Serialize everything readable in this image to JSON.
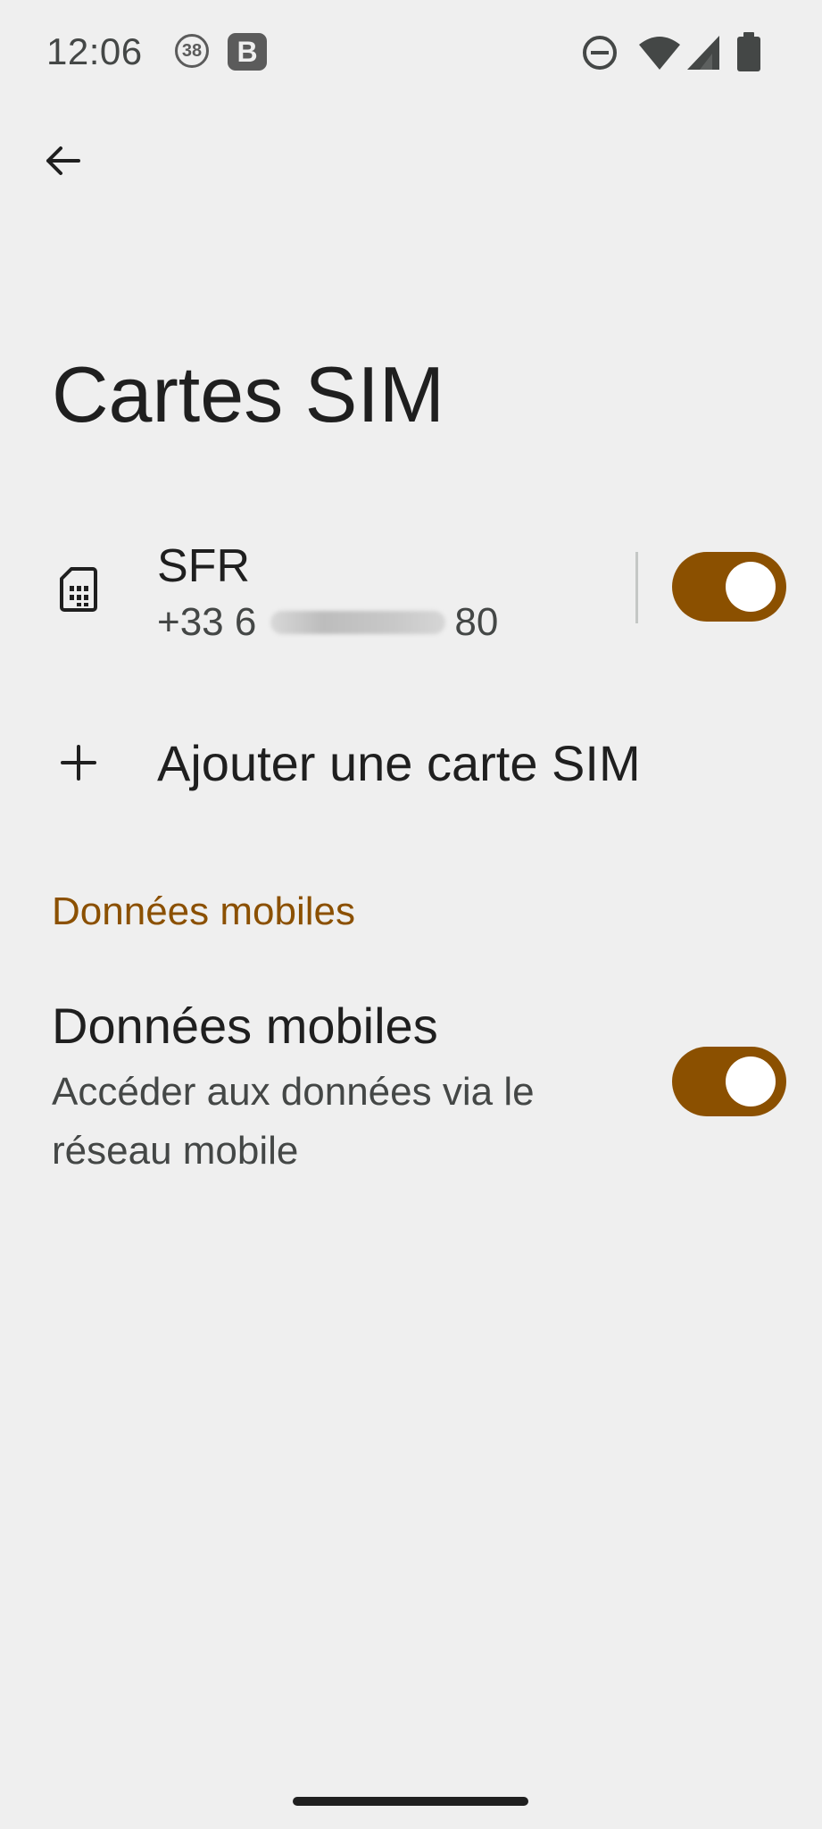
{
  "status_bar": {
    "time": "12:06",
    "notification_count": "38",
    "app_badge": "B",
    "icons": [
      "dnd-icon",
      "wifi-icon",
      "signal-icon",
      "battery-icon"
    ]
  },
  "header": {
    "back_icon": "arrow-back-icon",
    "title": "Cartes SIM"
  },
  "sim_card": {
    "icon": "sim-card-icon",
    "name": "SFR",
    "number_prefix": "+33 6",
    "number_suffix": "80",
    "enabled": true
  },
  "add_sim": {
    "icon": "plus-icon",
    "label": "Ajouter une carte SIM"
  },
  "mobile_data_section": {
    "header": "Données mobiles",
    "item": {
      "title": "Données mobiles",
      "summary": "Accéder aux données via le réseau mobile",
      "enabled": true
    }
  },
  "colors": {
    "accent": "#8b5000",
    "background": "#efefef",
    "text_primary": "#1f1f1f",
    "text_secondary": "#444746"
  }
}
